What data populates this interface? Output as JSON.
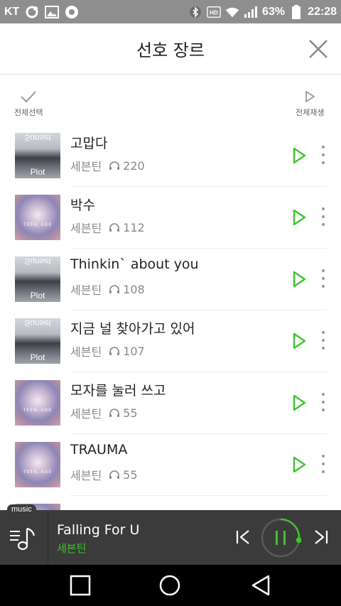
{
  "status_bar": {
    "carrier": "KT",
    "battery": "63%",
    "time": "22:28",
    "icons": [
      "notification-icon",
      "gallery-icon",
      "app-icon",
      "bluetooth-icon",
      "hd-icon",
      "wifi-icon",
      "signal-icon",
      "battery-icon"
    ]
  },
  "header": {
    "title": "선호 장르",
    "close_icon": "close-icon"
  },
  "toolbar": {
    "select_all": "전체선택",
    "play_all": "전체재생"
  },
  "songs": [
    {
      "title": "고맙다",
      "artist": "세븐틴",
      "plays": "220",
      "cover": "plot"
    },
    {
      "title": "박수",
      "artist": "세븐틴",
      "plays": "112",
      "cover": "teen"
    },
    {
      "title": "Thinkin` about you",
      "artist": "세븐틴",
      "plays": "108",
      "cover": "plot"
    },
    {
      "title": "지금 널 찾아가고 있어",
      "artist": "세븐틴",
      "plays": "107",
      "cover": "plot"
    },
    {
      "title": "모자를 눌러 쓰고",
      "artist": "세븐틴",
      "plays": "55",
      "cover": "teen"
    },
    {
      "title": "TRAUMA",
      "artist": "세븐틴",
      "plays": "55",
      "cover": "teen"
    }
  ],
  "cover_texts": {
    "plot_top": "Sunset",
    "plot_bottom": "Plot",
    "teen": "TEEN, AGE"
  },
  "player": {
    "tag": "music",
    "now_title": "Falling For U",
    "now_artist": "세븐틴",
    "progress": 0.27
  },
  "colors": {
    "accent": "#3ec42f",
    "status_bar": "#8e8e8e",
    "player_bg": "#3b3b3b"
  }
}
